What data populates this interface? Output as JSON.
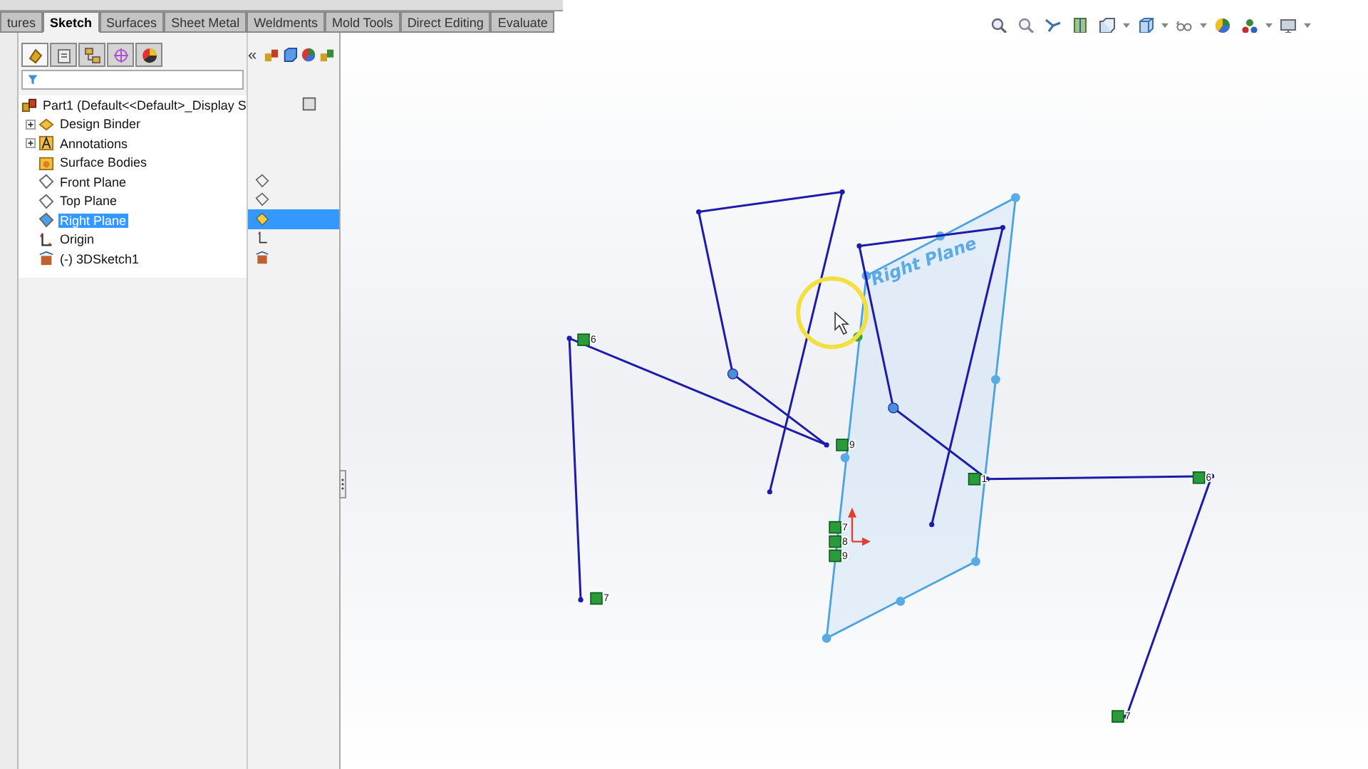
{
  "tabs": [
    {
      "label": "tures",
      "selected": false
    },
    {
      "label": "Sketch",
      "selected": true
    },
    {
      "label": "Surfaces",
      "selected": false
    },
    {
      "label": "Sheet Metal",
      "selected": false
    },
    {
      "label": "Weldments",
      "selected": false
    },
    {
      "label": "Mold Tools",
      "selected": false
    },
    {
      "label": "Direct Editing",
      "selected": false
    },
    {
      "label": "Evaluate",
      "selected": false
    }
  ],
  "panel": {
    "collapse": "«"
  },
  "tree": {
    "label": "Part1  (Default<<Default>_Display S",
    "kind": "part",
    "selected": false,
    "children": [
      {
        "label": "Design Binder",
        "kind": "binder",
        "expanded": false,
        "selected": false
      },
      {
        "label": "Annotations",
        "kind": "annotations",
        "expanded": false,
        "selected": false
      },
      {
        "label": "Surface Bodies",
        "kind": "bodies",
        "selected": false
      },
      {
        "label": "Front Plane",
        "kind": "plane",
        "selected": false
      },
      {
        "label": "Top Plane",
        "kind": "plane",
        "selected": false
      },
      {
        "label": "Right Plane",
        "kind": "plane",
        "selected": true
      },
      {
        "label": "Origin",
        "kind": "origin",
        "selected": false
      },
      {
        "label": "(-) 3DSketch1",
        "kind": "sketch",
        "selected": false
      }
    ]
  },
  "canvas": {
    "plane_label": "Right Plane",
    "relations": [
      {
        "label": "6"
      },
      {
        "label": "9"
      },
      {
        "label": "1"
      },
      {
        "label": "6"
      },
      {
        "label": "7"
      },
      {
        "label": "8"
      },
      {
        "label": "9"
      },
      {
        "label": "7"
      },
      {
        "label": "7"
      }
    ]
  }
}
